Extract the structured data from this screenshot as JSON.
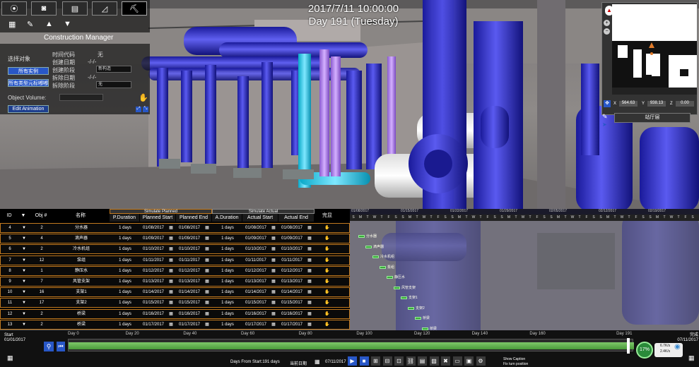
{
  "datetime": {
    "date": "2017/7/11 10:00:00",
    "day": "Day 191 (Tuesday)"
  },
  "manager": {
    "title": "Construction Manager"
  },
  "panel": {
    "select_label": "选择对象",
    "time_code": "时间代码",
    "created_date": "创建日期",
    "created_stage": "创建阶段",
    "demolish_date": "拆除日期",
    "demolish_stage": "拆除阶段",
    "all_instances": "所有实例",
    "all_types": "所有类型元标嘟嘟",
    "code_value": "无",
    "date_value": "-/-/-",
    "stage_value": "新构造",
    "demolish_date_value": "-/-/-",
    "demolish_stage_value": "无",
    "object_volume": "Object Volume:",
    "edit_animation": "Edit Animation"
  },
  "minimap": {
    "x_label": "X",
    "x_value": "564.63",
    "y_label": "Y",
    "y_value": "938.13",
    "z_label": "Z",
    "z_value": "0.00",
    "floor": "站厅层"
  },
  "grid": {
    "headers": {
      "id": "ID",
      "obj": "Obj #",
      "name": "名称",
      "pduration": "P.Duration",
      "pstart": "Planned Start",
      "pend": "Planned End",
      "aduration": "A.Duration",
      "astart": "Actual Start",
      "aend": "Actual End",
      "done": "完显"
    },
    "sim_planned": "Simulate Planned",
    "sim_actual": "Simulate Actual",
    "rows": [
      {
        "id": "4",
        "obj": "2",
        "name": "分水器",
        "pdur": "1 days",
        "pstart": "01/08/2017",
        "pend": "01/08/2017",
        "adur": "1 days",
        "astart": "01/08/2017",
        "aend": "01/08/2017"
      },
      {
        "id": "5",
        "obj": "4",
        "name": "滴声器",
        "pdur": "1 days",
        "pstart": "01/09/2017",
        "pend": "01/09/2017",
        "adur": "1 days",
        "astart": "01/09/2017",
        "aend": "01/09/2017"
      },
      {
        "id": "6",
        "obj": "2",
        "name": "冷水机组",
        "pdur": "1 days",
        "pstart": "01/10/2017",
        "pend": "01/10/2017",
        "adur": "1 days",
        "astart": "01/10/2017",
        "aend": "01/10/2017"
      },
      {
        "id": "7",
        "obj": "12",
        "name": "泵组",
        "pdur": "1 days",
        "pstart": "01/11/2017",
        "pend": "01/11/2017",
        "adur": "1 days",
        "astart": "01/11/2017",
        "aend": "01/11/2017"
      },
      {
        "id": "8",
        "obj": "1",
        "name": "静压水",
        "pdur": "1 days",
        "pstart": "01/12/2017",
        "pend": "01/12/2017",
        "adur": "1 days",
        "astart": "01/12/2017",
        "aend": "01/12/2017"
      },
      {
        "id": "9",
        "obj": "7",
        "name": "风管支架",
        "pdur": "1 days",
        "pstart": "01/13/2017",
        "pend": "01/13/2017",
        "adur": "1 days",
        "astart": "01/13/2017",
        "aend": "01/13/2017"
      },
      {
        "id": "10",
        "obj": "16",
        "name": "支架1",
        "pdur": "1 days",
        "pstart": "01/14/2017",
        "pend": "01/14/2017",
        "adur": "1 days",
        "astart": "01/14/2017",
        "aend": "01/14/2017"
      },
      {
        "id": "11",
        "obj": "17",
        "name": "支架2",
        "pdur": "1 days",
        "pstart": "01/15/2017",
        "pend": "01/15/2017",
        "adur": "1 days",
        "astart": "01/15/2017",
        "aend": "01/15/2017"
      },
      {
        "id": "12",
        "obj": "2",
        "name": "桥梁",
        "pdur": "1 days",
        "pstart": "01/16/2017",
        "pend": "01/16/2017",
        "adur": "1 days",
        "astart": "01/16/2017",
        "aend": "01/16/2017"
      },
      {
        "id": "13",
        "obj": "2",
        "name": "桥梁",
        "pdur": "1 days",
        "pstart": "01/17/2017",
        "pend": "01/17/2017",
        "adur": "1 days",
        "astart": "01/17/2017",
        "aend": "01/17/2017"
      }
    ]
  },
  "gantt": {
    "dates": [
      "01/08/2017",
      "01/15/2017",
      "01/22/2017",
      "01/29/2017",
      "02/05/2017",
      "02/12/2017",
      "02/19/2017"
    ],
    "weekdays": [
      "S",
      "M",
      "T",
      "W",
      "T",
      "F",
      "S",
      "S",
      "M",
      "T",
      "W",
      "T",
      "F",
      "S",
      "S",
      "M",
      "T",
      "W",
      "T",
      "F",
      "S",
      "S",
      "M",
      "T",
      "W",
      "T",
      "F",
      "S",
      "S",
      "M",
      "T",
      "W",
      "T",
      "F",
      "S",
      "S",
      "M",
      "T",
      "W",
      "T",
      "F",
      "S",
      "S",
      "M",
      "T",
      "W",
      "T",
      "F",
      "S"
    ],
    "tasks": [
      "分水器",
      "滴声器",
      "冷水机组",
      "泵组",
      "静压水",
      "风管支架",
      "支架1",
      "支架2",
      "桥梁",
      "桥梁"
    ]
  },
  "timeline": {
    "start_label": "Start",
    "start_date": "01/01/2017",
    "end_label": "完成",
    "end_date": "07/11/2017",
    "ticks": [
      "Day 0",
      "Day 20",
      "Day 40",
      "Day 60",
      "Day 80",
      "Day 100",
      "Day 120",
      "Day 140",
      "Day 160",
      "Day 191"
    ],
    "days_from_start": "Days From Start:191 days",
    "current_date_label": "当前日期",
    "current_date": "07/11/2017",
    "progress": "17%",
    "net_up": "6.7K/s",
    "net_down": "2.4K/s",
    "show_caption": "Show Caption",
    "fix_position": "Fix turn position"
  }
}
